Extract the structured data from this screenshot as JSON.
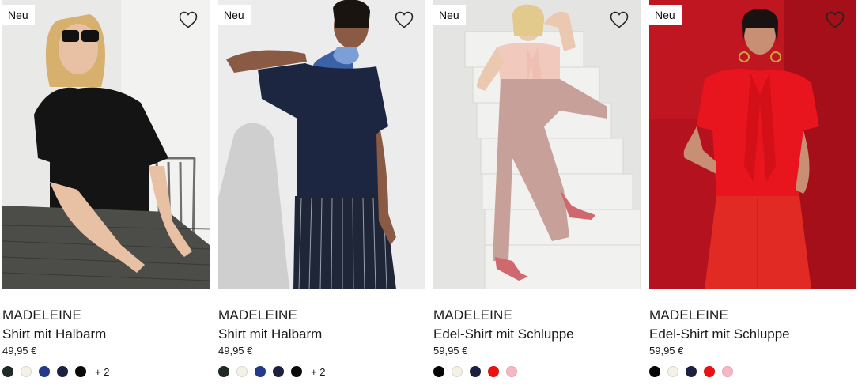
{
  "products": [
    {
      "badge": "Neu",
      "brand": "MADELEINE",
      "name": "Shirt mit Halbarm",
      "price": "49,95 €",
      "image_desc_icon": "model-photo",
      "swatches": [
        "#1f2a24",
        "#f4f2e6",
        "#243a8a",
        "#1c2140",
        "#0a0a0a"
      ],
      "more_colors": "+ 2"
    },
    {
      "badge": "Neu",
      "brand": "MADELEINE",
      "name": "Shirt mit Halbarm",
      "price": "49,95 €",
      "image_desc_icon": "model-photo",
      "swatches": [
        "#1f2a24",
        "#f4f2e6",
        "#243a8a",
        "#1c2140",
        "#0a0a0a"
      ],
      "more_colors": "+ 2"
    },
    {
      "badge": "Neu",
      "brand": "MADELEINE",
      "name": "Edel-Shirt mit Schluppe",
      "price": "59,95 €",
      "image_desc_icon": "model-photo",
      "swatches": [
        "#050505",
        "#f4f2e6",
        "#1c2140",
        "#ee1111",
        "#f7b6c4"
      ],
      "more_colors": ""
    },
    {
      "badge": "Neu",
      "brand": "MADELEINE",
      "name": "Edel-Shirt mit Schluppe",
      "price": "59,95 €",
      "image_desc_icon": "model-photo",
      "swatches": [
        "#050505",
        "#f4f2e6",
        "#1c2140",
        "#ee1111",
        "#f7b6c4"
      ],
      "more_colors": ""
    }
  ],
  "icons": {
    "favorite": "heart-outline-icon"
  },
  "colors": {
    "text": "#1a1a1a",
    "badge_bg": "#ffffff"
  }
}
